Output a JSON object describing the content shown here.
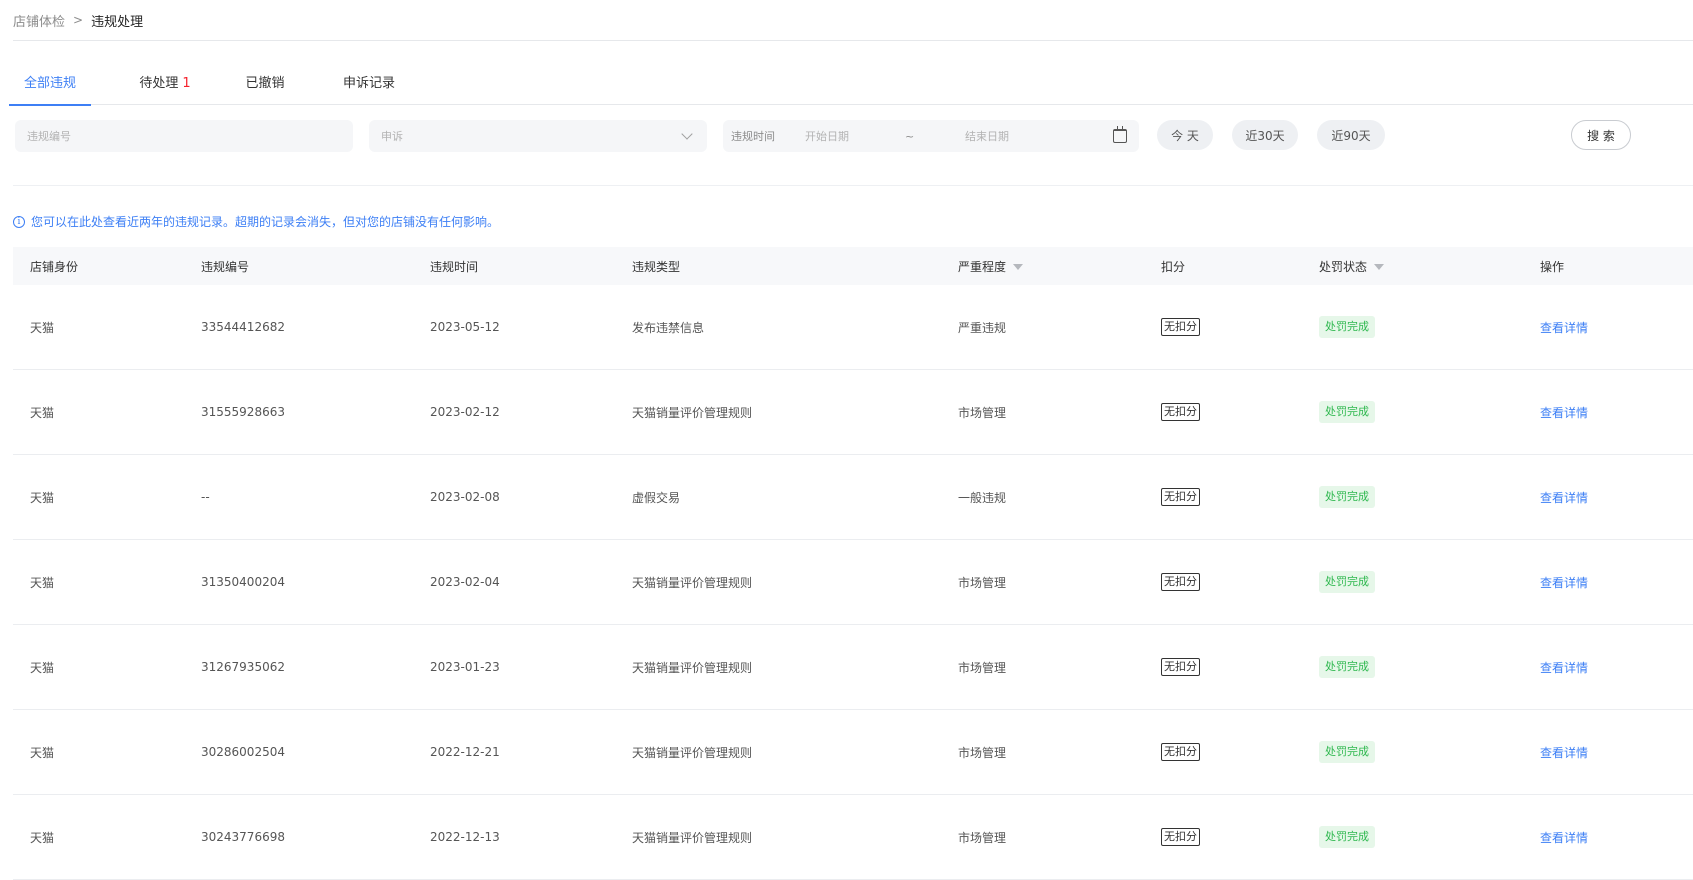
{
  "breadcrumb": {
    "parent": "店铺体检",
    "separator": ">",
    "current": "违规处理"
  },
  "tabs": [
    {
      "label": "全部违规",
      "count": ""
    },
    {
      "label": "待处理",
      "count": "1"
    },
    {
      "label": "已撤销",
      "count": ""
    },
    {
      "label": "申诉记录",
      "count": ""
    }
  ],
  "filters": {
    "violation_no_placeholder": "违规编号",
    "appeal_select_value": "申诉",
    "date_label": "违规时间",
    "date_start_placeholder": "开始日期",
    "date_tilde": "~",
    "date_end_placeholder": "结束日期",
    "quick": [
      "今 天",
      "近30天",
      "近90天"
    ],
    "search_label": "搜 索"
  },
  "notice": {
    "icon": "info-icon",
    "text": "您可以在此处查看近两年的违规记录。超期的记录会消失，但对您的店铺没有任何影响。"
  },
  "table": {
    "headers": [
      "店铺身份",
      "违规编号",
      "违规时间",
      "违规类型",
      "严重程度",
      "扣分",
      "处罚状态",
      "操作"
    ],
    "rows": [
      {
        "identity": "天猫",
        "number": "33544412682",
        "time": "2023-05-12",
        "type": "发布违禁信息",
        "severity": "严重违规",
        "deduct": "无扣分",
        "status": "处罚完成",
        "action": "查看详情"
      },
      {
        "identity": "天猫",
        "number": "31555928663",
        "time": "2023-02-12",
        "type": "天猫销量评价管理规则",
        "severity": "市场管理",
        "deduct": "无扣分",
        "status": "处罚完成",
        "action": "查看详情"
      },
      {
        "identity": "天猫",
        "number": "--",
        "time": "2023-02-08",
        "type": "虚假交易",
        "severity": "一般违规",
        "deduct": "无扣分",
        "status": "处罚完成",
        "action": "查看详情"
      },
      {
        "identity": "天猫",
        "number": "31350400204",
        "time": "2023-02-04",
        "type": "天猫销量评价管理规则",
        "severity": "市场管理",
        "deduct": "无扣分",
        "status": "处罚完成",
        "action": "查看详情"
      },
      {
        "identity": "天猫",
        "number": "31267935062",
        "time": "2023-01-23",
        "type": "天猫销量评价管理规则",
        "severity": "市场管理",
        "deduct": "无扣分",
        "status": "处罚完成",
        "action": "查看详情"
      },
      {
        "identity": "天猫",
        "number": "30286002504",
        "time": "2022-12-21",
        "type": "天猫销量评价管理规则",
        "severity": "市场管理",
        "deduct": "无扣分",
        "status": "处罚完成",
        "action": "查看详情"
      },
      {
        "identity": "天猫",
        "number": "30243776698",
        "time": "2022-12-13",
        "type": "天猫销量评价管理规则",
        "severity": "市场管理",
        "deduct": "无扣分",
        "status": "处罚完成",
        "action": "查看详情"
      }
    ]
  },
  "colors": {
    "accent": "#3d7ff5",
    "alert": "#f5222d",
    "success_text": "#2fb84f",
    "success_bg": "#e6f7e9"
  }
}
